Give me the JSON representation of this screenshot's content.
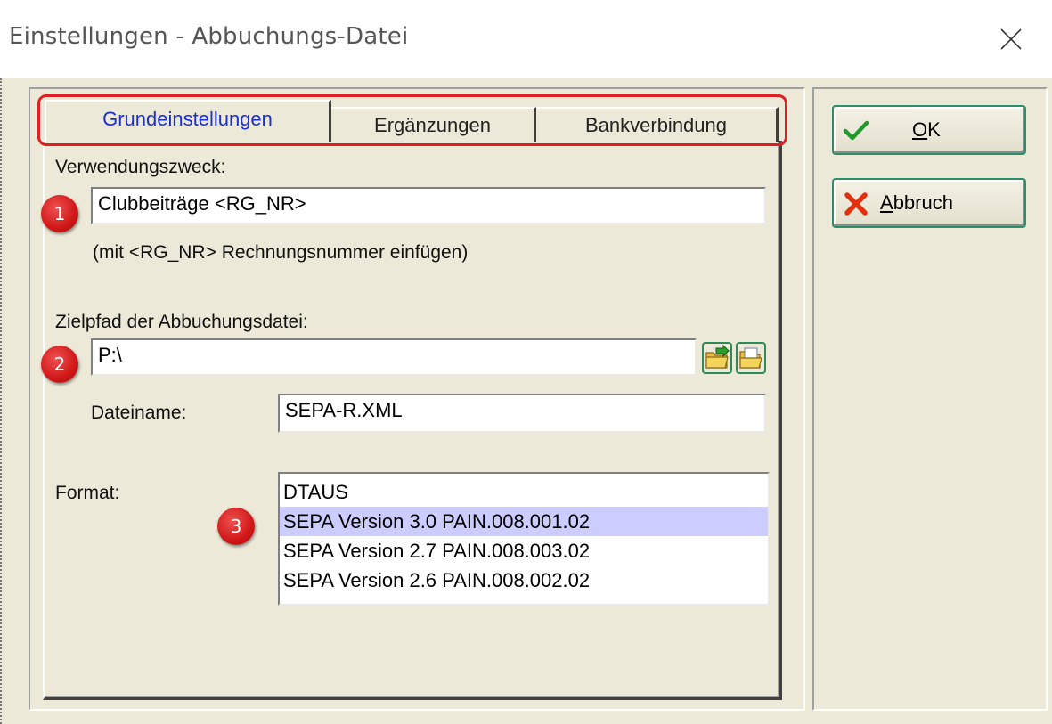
{
  "window": {
    "title": "Einstellungen - Abbuchungs-Datei"
  },
  "tabs": [
    {
      "label": "Grundeinstellungen",
      "active": true
    },
    {
      "label": "Ergänzungen",
      "active": false
    },
    {
      "label": "Bankverbindung",
      "active": false
    }
  ],
  "form": {
    "purpose_label": "Verwendungszweck:",
    "purpose_value": "Clubbeiträge <RG_NR>",
    "purpose_hint": "(mit <RG_NR> Rechnungsnummer einfügen)",
    "path_label": "Zielpfad der Abbuchungsdatei:",
    "path_value": "P:\\",
    "filename_label": "Dateiname:",
    "filename_value": "SEPA-R.XML",
    "format_label": "Format:",
    "format_options": [
      "DTAUS",
      "SEPA Version 3.0 PAIN.008.001.02",
      "SEPA Version 2.7 PAIN.008.003.02",
      "SEPA Version 2.6 PAIN.008.002.02"
    ],
    "format_selected_index": 1
  },
  "badges": [
    "1",
    "2",
    "3"
  ],
  "buttons": {
    "ok_label": "OK",
    "cancel_label": "Abbruch"
  },
  "icons": {
    "close": "close-icon",
    "ok": "checkmark-icon",
    "cancel": "x-cross-icon",
    "browse_folder": "folder-arrow-icon",
    "open_folder": "folder-open-icon"
  },
  "colors": {
    "dialog_bg": "#ece9d8",
    "active_tab_text": "#1a2fd8",
    "highlight_red": "#e02020",
    "selected_row": "#ccccff",
    "button_border": "#2d8f6a"
  }
}
